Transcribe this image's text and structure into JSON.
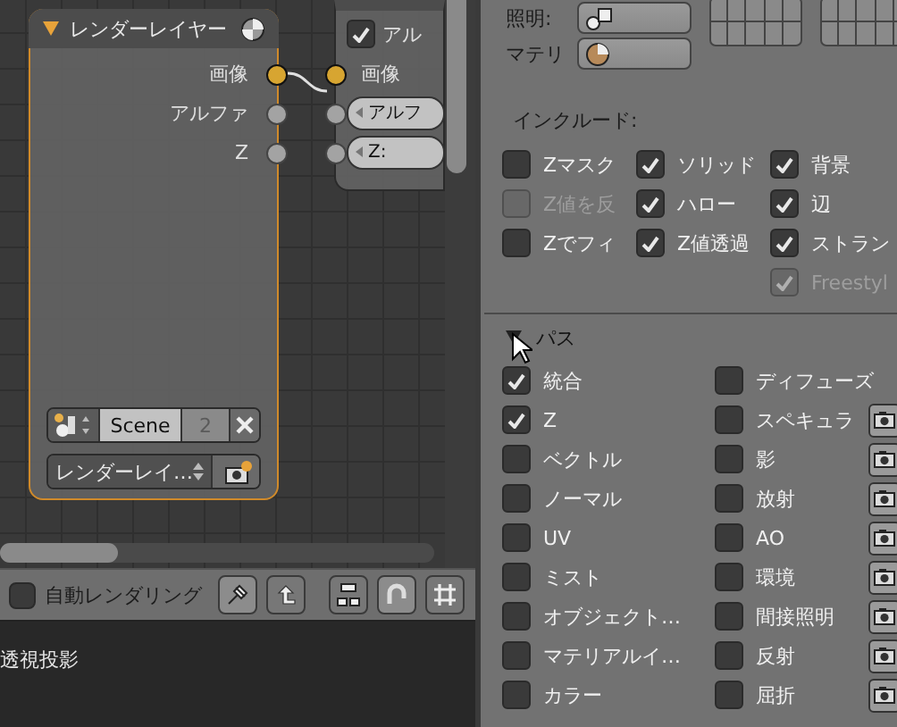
{
  "render_layer_node": {
    "title": "レンダーレイヤー",
    "selected": true,
    "outputs": [
      {
        "label": "画像",
        "kind": "image",
        "connected": true
      },
      {
        "label": "アルファ",
        "kind": "value",
        "connected": false
      },
      {
        "label": "Z",
        "kind": "value",
        "connected": false
      }
    ],
    "scene": {
      "name": "Scene",
      "users": "2"
    },
    "layer": "レンダーレイ…"
  },
  "composite_node": {
    "use_alpha": {
      "label": "アル",
      "checked": true
    },
    "inputs": [
      {
        "label": "画像",
        "kind": "image",
        "field": false,
        "connected": true
      },
      {
        "label": "アルフ",
        "kind": "value",
        "field": true,
        "connected": false
      },
      {
        "label": "Z:",
        "kind": "value",
        "field": true,
        "connected": false
      }
    ]
  },
  "header_bar": {
    "auto_render": {
      "label": "自動レンダリング",
      "checked": false
    }
  },
  "viewport": {
    "label": "透視投影"
  },
  "properties": {
    "lighting_label": "照明:",
    "material_label": "マテリ",
    "include_label": "インクルード:",
    "include_columns": [
      [
        {
          "label": "Zマスク",
          "checked": false,
          "disabled": false
        },
        {
          "label": "Z値を反",
          "checked": false,
          "disabled": true
        },
        {
          "label": "Zでフィ",
          "checked": false,
          "disabled": false
        }
      ],
      [
        {
          "label": "ソリッド",
          "checked": true,
          "disabled": false
        },
        {
          "label": "ハロー",
          "checked": true,
          "disabled": false
        },
        {
          "label": "Z値透過",
          "checked": true,
          "disabled": false
        }
      ],
      [
        {
          "label": "背景",
          "checked": true,
          "disabled": false
        },
        {
          "label": "辺",
          "checked": true,
          "disabled": false
        },
        {
          "label": "ストラン",
          "checked": true,
          "disabled": false
        },
        {
          "label": "Freestyl",
          "checked": true,
          "disabled": true
        }
      ]
    ],
    "passes": {
      "title": "パス",
      "expanded": true,
      "columns": [
        [
          {
            "label": "統合",
            "checked": true,
            "exclude_button": false
          },
          {
            "label": "Z",
            "checked": true,
            "exclude_button": false
          },
          {
            "label": "ベクトル",
            "checked": false,
            "exclude_button": false
          },
          {
            "label": "ノーマル",
            "checked": false,
            "exclude_button": false
          },
          {
            "label": "UV",
            "checked": false,
            "exclude_button": false
          },
          {
            "label": "ミスト",
            "checked": false,
            "exclude_button": false
          },
          {
            "label": "オブジェクト…",
            "checked": false,
            "exclude_button": false
          },
          {
            "label": "マテリアルイ…",
            "checked": false,
            "exclude_button": false
          },
          {
            "label": "カラー",
            "checked": false,
            "exclude_button": false
          }
        ],
        [
          {
            "label": "ディフューズ",
            "checked": false,
            "exclude_button": false
          },
          {
            "label": "スペキュラ",
            "checked": false,
            "exclude_button": true
          },
          {
            "label": "影",
            "checked": false,
            "exclude_button": true
          },
          {
            "label": "放射",
            "checked": false,
            "exclude_button": true
          },
          {
            "label": "AO",
            "checked": false,
            "exclude_button": true
          },
          {
            "label": "環境",
            "checked": false,
            "exclude_button": true
          },
          {
            "label": "間接照明",
            "checked": false,
            "exclude_button": true
          },
          {
            "label": "反射",
            "checked": false,
            "exclude_button": true
          },
          {
            "label": "屈折",
            "checked": false,
            "exclude_button": true
          }
        ]
      ]
    }
  }
}
